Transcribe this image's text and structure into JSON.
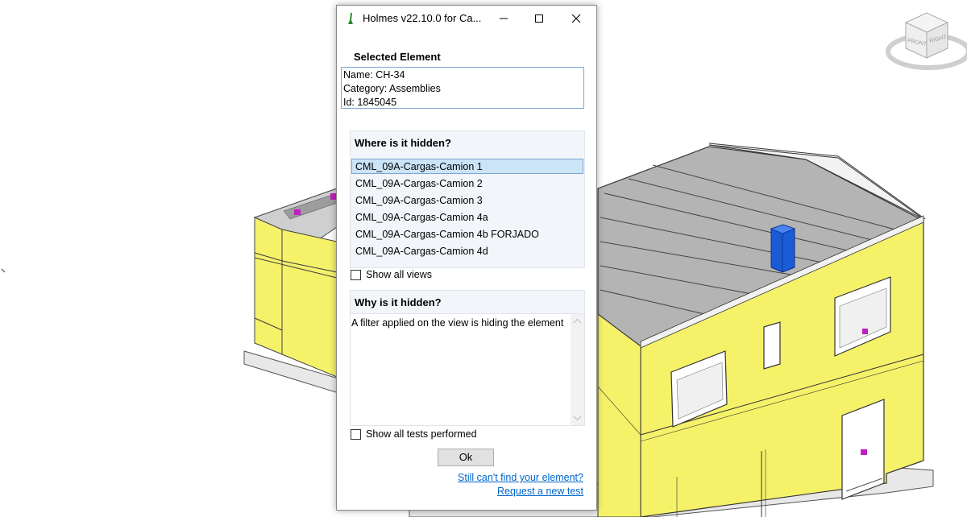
{
  "dialog": {
    "title": "Holmes v22.10.0 for Ca...",
    "selected_element": {
      "heading": "Selected Element",
      "name_line": "Name: CH-34",
      "category_line": "Category: Assemblies",
      "id_line": "Id: 1845045"
    },
    "where_hidden": {
      "heading": "Where is it hidden?",
      "views": [
        "CML_09A-Cargas-Camion 1",
        "CML_09A-Cargas-Camion 2",
        "CML_09A-Cargas-Camion 3",
        "CML_09A-Cargas-Camion 4a",
        "CML_09A-Cargas-Camion 4b FORJADO",
        "CML_09A-Cargas-Camion 4d"
      ],
      "selected_index": 0,
      "show_all_views_label": "Show all views",
      "show_all_views_checked": false
    },
    "why_hidden": {
      "heading": "Why is it hidden?",
      "reason": "A filter applied on the view is hiding the element",
      "show_all_tests_label": "Show all tests performed",
      "show_all_tests_checked": false
    },
    "ok_label": "Ok",
    "link_not_found": "Still can't find your element?",
    "link_request_test": "Request a new test"
  },
  "viewcube": {
    "front_label": "FRONT",
    "right_label": "RIGHT"
  },
  "colors": {
    "wall_yellow": "#f5f26a",
    "roof_gray": "#b4b4b4",
    "selection_blue": "#1a5bd6",
    "link_blue": "#0066cc",
    "list_selected": "#cce4f7"
  }
}
